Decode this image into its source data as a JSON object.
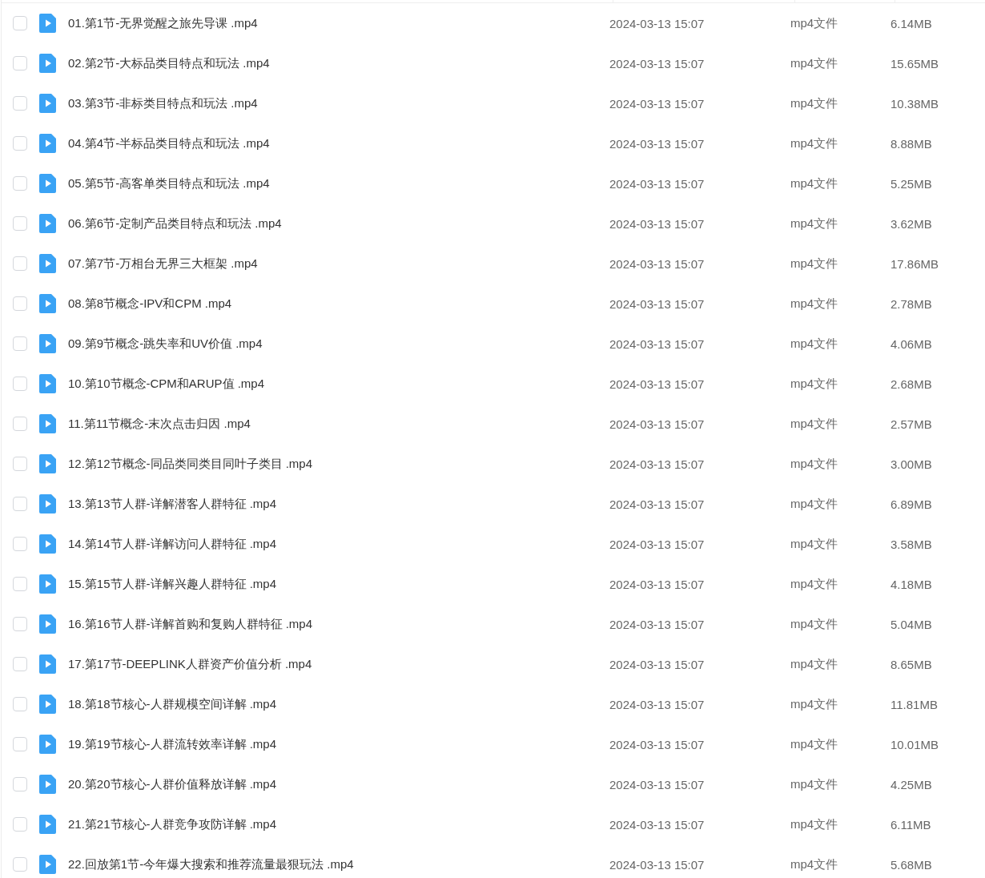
{
  "files": [
    {
      "name": "01.第1节-无界觉醒之旅先导课 .mp4",
      "modified": "2024-03-13 15:07",
      "type": "mp4文件",
      "size": "6.14MB",
      "checked": false
    },
    {
      "name": "02.第2节-大标品类目特点和玩法 .mp4",
      "modified": "2024-03-13 15:07",
      "type": "mp4文件",
      "size": "15.65MB",
      "checked": false
    },
    {
      "name": "03.第3节-非标类目特点和玩法 .mp4",
      "modified": "2024-03-13 15:07",
      "type": "mp4文件",
      "size": "10.38MB",
      "checked": false
    },
    {
      "name": "04.第4节-半标品类目特点和玩法 .mp4",
      "modified": "2024-03-13 15:07",
      "type": "mp4文件",
      "size": "8.88MB",
      "checked": false
    },
    {
      "name": "05.第5节-高客单类目特点和玩法 .mp4",
      "modified": "2024-03-13 15:07",
      "type": "mp4文件",
      "size": "5.25MB",
      "checked": false
    },
    {
      "name": "06.第6节-定制产品类目特点和玩法 .mp4",
      "modified": "2024-03-13 15:07",
      "type": "mp4文件",
      "size": "3.62MB",
      "checked": false
    },
    {
      "name": "07.第7节-万相台无界三大框架 .mp4",
      "modified": "2024-03-13 15:07",
      "type": "mp4文件",
      "size": "17.86MB",
      "checked": false
    },
    {
      "name": "08.第8节概念-IPV和CPM .mp4",
      "modified": "2024-03-13 15:07",
      "type": "mp4文件",
      "size": "2.78MB",
      "checked": false
    },
    {
      "name": "09.第9节概念-跳失率和UV价值 .mp4",
      "modified": "2024-03-13 15:07",
      "type": "mp4文件",
      "size": "4.06MB",
      "checked": false
    },
    {
      "name": "10.第10节概念-CPM和ARUP值 .mp4",
      "modified": "2024-03-13 15:07",
      "type": "mp4文件",
      "size": "2.68MB",
      "checked": false
    },
    {
      "name": "11.第11节概念-末次点击归因 .mp4",
      "modified": "2024-03-13 15:07",
      "type": "mp4文件",
      "size": "2.57MB",
      "checked": false
    },
    {
      "name": "12.第12节概念-同品类同类目同叶子类目 .mp4",
      "modified": "2024-03-13 15:07",
      "type": "mp4文件",
      "size": "3.00MB",
      "checked": false
    },
    {
      "name": "13.第13节人群-详解潜客人群特征 .mp4",
      "modified": "2024-03-13 15:07",
      "type": "mp4文件",
      "size": "6.89MB",
      "checked": false
    },
    {
      "name": "14.第14节人群-详解访问人群特征 .mp4",
      "modified": "2024-03-13 15:07",
      "type": "mp4文件",
      "size": "3.58MB",
      "checked": false
    },
    {
      "name": "15.第15节人群-详解兴趣人群特征 .mp4",
      "modified": "2024-03-13 15:07",
      "type": "mp4文件",
      "size": "4.18MB",
      "checked": false
    },
    {
      "name": "16.第16节人群-详解首购和复购人群特征 .mp4",
      "modified": "2024-03-13 15:07",
      "type": "mp4文件",
      "size": "5.04MB",
      "checked": false
    },
    {
      "name": "17.第17节-DEEPLINK人群资产价值分析 .mp4",
      "modified": "2024-03-13 15:07",
      "type": "mp4文件",
      "size": "8.65MB",
      "checked": false
    },
    {
      "name": "18.第18节核心-人群规模空间详解 .mp4",
      "modified": "2024-03-13 15:07",
      "type": "mp4文件",
      "size": "11.81MB",
      "checked": false
    },
    {
      "name": "19.第19节核心-人群流转效率详解 .mp4",
      "modified": "2024-03-13 15:07",
      "type": "mp4文件",
      "size": "10.01MB",
      "checked": false
    },
    {
      "name": "20.第20节核心-人群价值释放详解 .mp4",
      "modified": "2024-03-13 15:07",
      "type": "mp4文件",
      "size": "4.25MB",
      "checked": false
    },
    {
      "name": "21.第21节核心-人群竞争攻防详解 .mp4",
      "modified": "2024-03-13 15:07",
      "type": "mp4文件",
      "size": "6.11MB",
      "checked": false
    },
    {
      "name": "22.回放第1节-今年爆大搜索和推荐流量最狠玩法 .mp4",
      "modified": "2024-03-13 15:07",
      "type": "mp4文件",
      "size": "5.68MB",
      "checked": false
    }
  ]
}
